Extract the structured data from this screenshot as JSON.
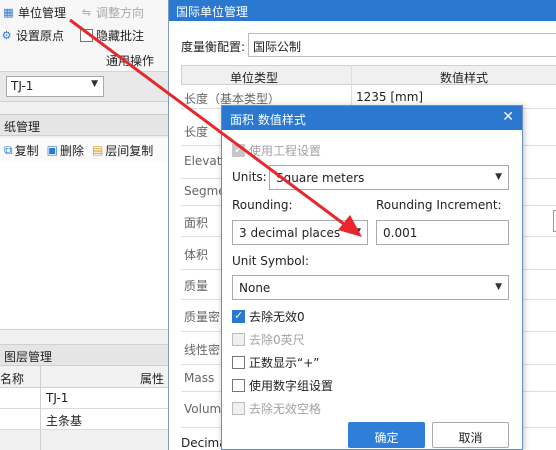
{
  "ribbon": {
    "unit_mgmt": "单位管理",
    "adjust_dir": "调整方向",
    "set_origin": "设置原点",
    "hide_annot": "隐藏批注",
    "group_label": "通用操作"
  },
  "selector": {
    "value": "TJ-1"
  },
  "drawing_panel": {
    "title": "纸管理",
    "copy": "复制",
    "delete": "删除",
    "floor_copy": "层间复制"
  },
  "layer_panel": {
    "title": "图层管理",
    "col_name": "名称",
    "col_prop": "属性",
    "rows": [
      "TJ-1",
      "主条基"
    ]
  },
  "unit_window": {
    "title": "国际单位管理",
    "config_label": "度量衡配置:",
    "config_value": "国际公制",
    "col_unit_type": "单位类型",
    "col_value_style": "数值样式",
    "rows": [
      {
        "type": "长度（基本类型）",
        "value": "1235 [mm]"
      },
      {
        "type": "长度",
        "value": ""
      },
      {
        "type": "Elevati",
        "value": ""
      },
      {
        "type": "Segme",
        "value": ""
      },
      {
        "type": "面积",
        "value": ""
      },
      {
        "type": "体积",
        "value": ""
      },
      {
        "type": "质量",
        "value": ""
      },
      {
        "type": "质量密",
        "value": ""
      },
      {
        "type": "线性密",
        "value": ""
      },
      {
        "type": "Mass",
        "value": ""
      },
      {
        "type": "Volum",
        "value": ""
      }
    ],
    "bottom_text": "Decima"
  },
  "dialog": {
    "title": "面积 数值样式",
    "use_project": "使用工程设置",
    "units_label": "Units:",
    "units_value": "Square meters",
    "rounding_label": "Rounding:",
    "rounding_value": "3 decimal places",
    "increment_label": "Rounding Increment:",
    "increment_value": "0.001",
    "symbol_label": "Unit Symbol:",
    "symbol_value": "None",
    "opt_remove_zero": "去除无效0",
    "opt_remove_feet": "去除0英尺",
    "opt_show_plus": "正数显示“+”",
    "opt_digit_group": "使用数字组设置",
    "opt_remove_space": "去除无效空格",
    "ok": "确定",
    "cancel": "取消"
  },
  "colors": {
    "title_blue": "#2b78d0",
    "annotation_red": "#e8262d"
  }
}
